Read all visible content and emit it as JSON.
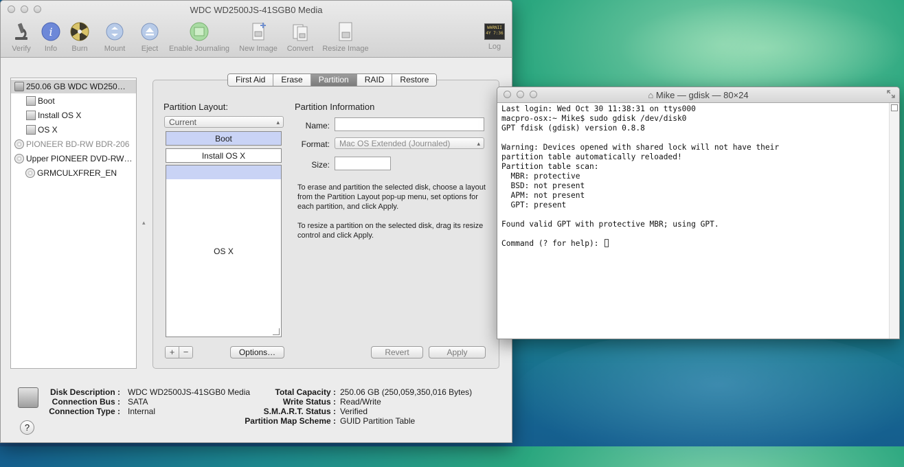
{
  "disk_utility": {
    "title": "WDC WD2500JS-41SGB0 Media",
    "toolbar": [
      {
        "label": "Verify",
        "icon": "microscope-icon"
      },
      {
        "label": "Info",
        "icon": "info-icon"
      },
      {
        "label": "Burn",
        "icon": "burn-icon"
      },
      {
        "label": "Mount",
        "icon": "mount-icon"
      },
      {
        "label": "Eject",
        "icon": "eject-icon"
      },
      {
        "label": "Enable Journaling",
        "icon": "journaling-icon"
      },
      {
        "label": "New Image",
        "icon": "new-image-icon"
      },
      {
        "label": "Convert",
        "icon": "convert-icon"
      },
      {
        "label": "Resize Image",
        "icon": "resize-image-icon"
      },
      {
        "label": "Log",
        "icon": "log-icon",
        "log_text": "WARNII 4Y 7:36"
      }
    ],
    "sidebar": [
      {
        "label": "250.06 GB WDC WD250…"
      },
      {
        "label": "Boot"
      },
      {
        "label": "Install OS X"
      },
      {
        "label": "OS X"
      },
      {
        "label": "PIONEER BD-RW BDR-206"
      },
      {
        "label": "Upper PIONEER DVD-RW…"
      },
      {
        "label": "GRMCULXFRER_EN"
      }
    ],
    "tabs": [
      "First Aid",
      "Erase",
      "Partition",
      "RAID",
      "Restore"
    ],
    "partition": {
      "layout_label": "Partition Layout:",
      "layout_value": "Current",
      "partitions": [
        "Boot",
        "Install OS X",
        "OS X"
      ],
      "info_label": "Partition Information",
      "name_label": "Name:",
      "name_value": "",
      "format_label": "Format:",
      "format_value": "Mac OS Extended (Journaled)",
      "size_label": "Size:",
      "size_value": "",
      "help1": "To erase and partition the selected disk, choose a layout from the Partition Layout pop-up menu, set options for each partition, and click Apply.",
      "help2": "To resize a partition on the selected disk, drag its resize control and click Apply.",
      "plus": "+",
      "minus": "−",
      "options_btn": "Options…",
      "revert_btn": "Revert",
      "apply_btn": "Apply"
    },
    "info_left": [
      {
        "key": "Disk Description :",
        "value": "WDC WD2500JS-41SGB0 Media"
      },
      {
        "key": "Connection Bus :",
        "value": "SATA"
      },
      {
        "key": "Connection Type :",
        "value": "Internal"
      }
    ],
    "info_right": [
      {
        "key": "Total Capacity :",
        "value": "250.06 GB (250,059,350,016 Bytes)"
      },
      {
        "key": "Write Status :",
        "value": "Read/Write"
      },
      {
        "key": "S.M.A.R.T. Status :",
        "value": "Verified"
      },
      {
        "key": "Partition Map Scheme :",
        "value": "GUID Partition Table"
      }
    ],
    "help_btn": "?"
  },
  "terminal": {
    "title": "Mike — gdisk — 80×24",
    "lines": [
      "Last login: Wed Oct 30 11:38:31 on ttys000",
      "macpro-osx:~ Mike$ sudo gdisk /dev/disk0",
      "GPT fdisk (gdisk) version 0.8.8",
      "",
      "Warning: Devices opened with shared lock will not have their",
      "partition table automatically reloaded!",
      "Partition table scan:",
      "  MBR: protective",
      "  BSD: not present",
      "  APM: not present",
      "  GPT: present",
      "",
      "Found valid GPT with protective MBR; using GPT.",
      "",
      "Command (? for help): "
    ]
  }
}
